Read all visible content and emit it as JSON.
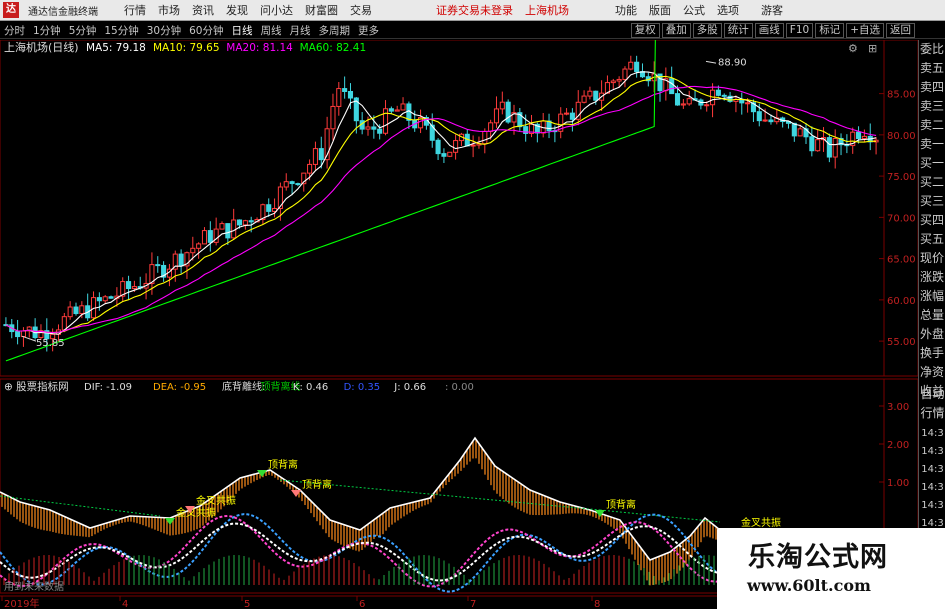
{
  "titlebar": {
    "app_name": "通达信金融终端",
    "menus": [
      "行情",
      "市场",
      "资讯",
      "发现",
      "问小达",
      "财富圈",
      "交易"
    ],
    "notice": "证券交易未登录",
    "stock_title": "上海机场",
    "right_menus": [
      "功能",
      "版面",
      "公式",
      "选项"
    ],
    "guest": "游客"
  },
  "periods": [
    "分时",
    "1分钟",
    "5分钟",
    "15分钟",
    "30分钟",
    "60分钟",
    "日线",
    "周线",
    "月线",
    "多周期",
    "更多"
  ],
  "selected_period": "日线",
  "toolbar_right": [
    "复权",
    "叠加",
    "多股",
    "统计",
    "画线",
    "F10",
    "标记",
    "+自选",
    "返回"
  ],
  "main_chart": {
    "title": "上海机场(日线)",
    "ma": [
      {
        "label": "MA5: 79.18",
        "color": "#ffffff"
      },
      {
        "label": "MA10: 79.65",
        "color": "#ffff00"
      },
      {
        "label": "MA20: 81.14",
        "color": "#ff00ff"
      },
      {
        "label": "MA60: 82.41",
        "color": "#00ff00"
      }
    ],
    "yticks": [
      "85.00",
      "80.00",
      "75.00",
      "70.00",
      "65.00",
      "60.00",
      "55.00"
    ],
    "high_label": "88.90",
    "low_label": "55.85"
  },
  "indicator": {
    "name": "股票指标网",
    "values": [
      {
        "label": "DIF: -1.09",
        "color": "#dddddd"
      },
      {
        "label": "DEA: -0.95",
        "color": "#ffaa00"
      },
      {
        "label": "底背離线:",
        "color": "#dddddd"
      },
      {
        "label": "顶背离线",
        "color": "#00cc00"
      },
      {
        "label": "K: 0.46",
        "color": "#dddddd"
      },
      {
        "label": "D: 0.35",
        "color": "#3355ff"
      },
      {
        "label": "J: 0.66",
        "color": "#dddddd"
      },
      {
        "label": ": 0.00",
        "color": "#888888"
      }
    ],
    "yticks": [
      "3.00",
      "2.00",
      "1.00"
    ],
    "annotations": [
      {
        "text": "金叉共振",
        "color": "#ffff00"
      },
      {
        "text": "金叉共振",
        "color": "#ffff00"
      },
      {
        "text": "顶背离",
        "color": "#ffff00"
      },
      {
        "text": "顶背离",
        "color": "#ffff00"
      },
      {
        "text": "顶背离",
        "color": "#ffff00"
      },
      {
        "text": "金叉共振",
        "color": "#ffff00"
      }
    ],
    "footnote": "用到未来数据"
  },
  "xaxis": [
    "2019年",
    "4",
    "5",
    "6",
    "7",
    "8"
  ],
  "right_panel": [
    "委比",
    "卖五",
    "卖四",
    "卖三",
    "卖二",
    "卖一",
    "买一",
    "买二",
    "买三",
    "买四",
    "买五",
    "现价",
    "涨跌",
    "涨幅",
    "总量",
    "外盘",
    "换手",
    "净资",
    "收益"
  ],
  "right_panel_bottom": [
    "自动",
    "行情"
  ],
  "right_times": [
    "14:3",
    "14:3",
    "14:3",
    "14:3",
    "14:3",
    "14:3",
    "14:3",
    "14:3"
  ],
  "watermark": {
    "title": "乐淘公式网",
    "url": "www.60lt.com"
  }
}
